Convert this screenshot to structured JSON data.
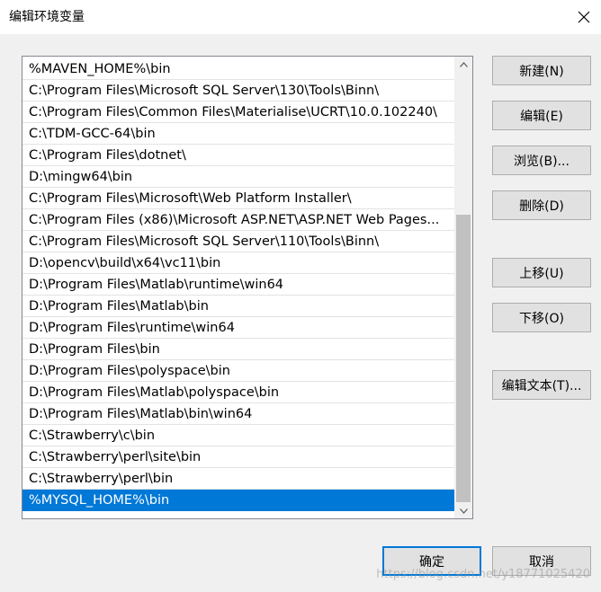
{
  "window": {
    "title": "编辑环境变量"
  },
  "path_list": {
    "items": [
      "%MAVEN_HOME%\\bin",
      "C:\\Program Files\\Microsoft SQL Server\\130\\Tools\\Binn\\",
      "C:\\Program Files\\Common Files\\Materialise\\UCRT\\10.0.102240\\",
      "C:\\TDM-GCC-64\\bin",
      "C:\\Program Files\\dotnet\\",
      "D:\\mingw64\\bin",
      "C:\\Program Files\\Microsoft\\Web Platform Installer\\",
      "C:\\Program Files (x86)\\Microsoft ASP.NET\\ASP.NET Web Pages...",
      "C:\\Program Files\\Microsoft SQL Server\\110\\Tools\\Binn\\",
      "D:\\opencv\\build\\x64\\vc11\\bin",
      "D:\\Program Files\\Matlab\\runtime\\win64",
      "D:\\Program Files\\Matlab\\bin",
      "D:\\Program Files\\runtime\\win64",
      "D:\\Program Files\\bin",
      "D:\\Program Files\\polyspace\\bin",
      "D:\\Program Files\\Matlab\\polyspace\\bin",
      "D:\\Program Files\\Matlab\\bin\\win64",
      "C:\\Strawberry\\c\\bin",
      "C:\\Strawberry\\perl\\site\\bin",
      "C:\\Strawberry\\perl\\bin",
      "%MYSQL_HOME%\\bin"
    ],
    "selected_index": 20
  },
  "buttons": {
    "new": "新建(N)",
    "edit": "编辑(E)",
    "browse": "浏览(B)...",
    "delete": "删除(D)",
    "move_up": "上移(U)",
    "move_down": "下移(O)",
    "edit_text": "编辑文本(T)...",
    "ok": "确定",
    "cancel": "取消"
  },
  "watermark": "https://blog.csdn.net/y18771025420",
  "colors": {
    "selection": "#0078d7",
    "background": "#f0f0f0",
    "focus_border": "#0078d7"
  }
}
